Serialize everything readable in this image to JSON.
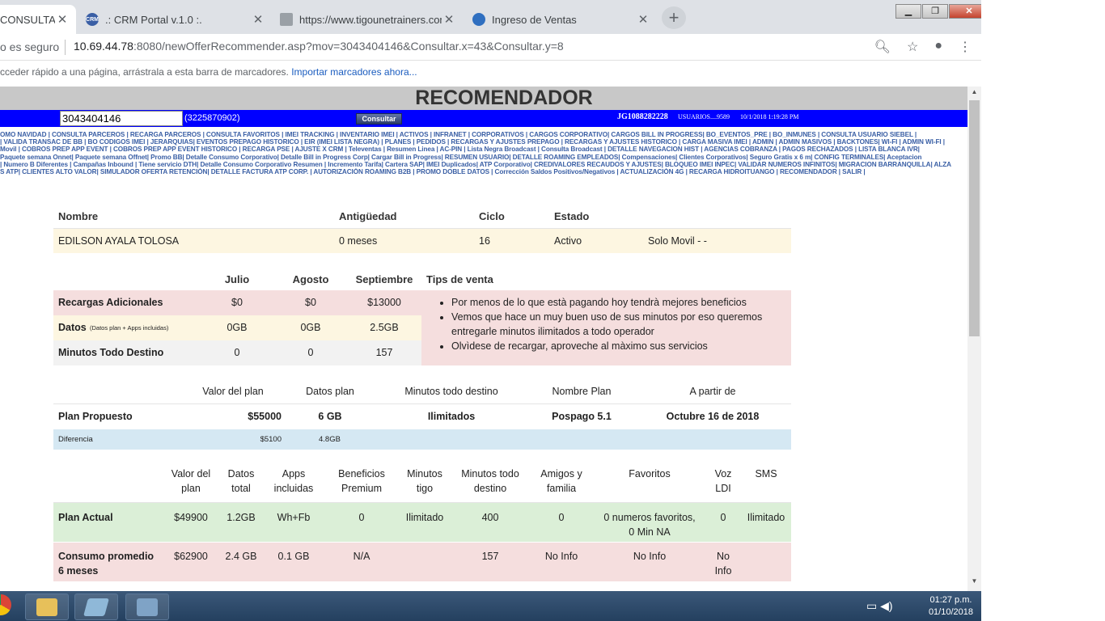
{
  "browser": {
    "tabs": [
      {
        "title": "CONSULTA IN",
        "active": true,
        "icon": "page-icon",
        "color": "#ffffff"
      },
      {
        "title": ".: CRM Portal v.1.0 :.",
        "active": false,
        "icon": "crm-icon",
        "color": "#3a5fa5"
      },
      {
        "title": "https://www.tigounetrainers.com",
        "active": false,
        "icon": "document-icon",
        "color": "#9aa0a6"
      },
      {
        "title": "Ingreso de Ventas",
        "active": false,
        "icon": "sales-icon",
        "color": "#2f6fc0"
      }
    ],
    "security_label": "o es seguro",
    "url_host": "10.69.44.78",
    "url_rest": ":8080/newOfferRecommender.asp?mov=3043404146&Consultar.x=43&Consultar.y=8",
    "bookmarks_prompt": "cceder rápido a una página, arrástrala a esta barra de marcadores.",
    "bookmarks_link": "Importar marcadores ahora..."
  },
  "header": {
    "title": "RECOMENDADOR",
    "msisdn_value": "3043404146",
    "alt_number": "(3225870902)",
    "consultar_label": "Consultar",
    "user_id": "JG1088282228",
    "user_meta": "USUARIOS....9589",
    "user_date": "10/1/2018 1:19:28 PM"
  },
  "menu_lines": [
    "OMO NAVIDAD | CONSULTA PARCEROS | RECARGA PARCEROS | CONSULTA FAVORITOS | IMEI TRACKING | INVENTARIO IMEI | ACTIVOS | INFRANET | CORPORATIVOS | CARGOS CORPORATIVO| CARGOS BILL IN PROGRESS| BO_EVENTOS_PRE | BO_INMUNES | CONSULTA USUARIO SIEBEL |",
    "| VALIDA TRANSAC DE BB | BO CODIGOS IMEI | JERARQUIAS| EVENTOS PREPAGO HISTORICO | EIR (IMEI LISTA NEGRA) | PLANES | PEDIDOS | RECARGAS Y AJUSTES PREPAGO | RECARGAS Y AJUSTES HISTORICO | CARGA MASIVA IMEI | ADMIN | ADMIN MASIVOS | BACKTONES| WI-FI | ADMIN WI-FI |",
    "Movil | COBROS PREP APP EVENT | COBROS PREP APP EVENT HISTORICO | RECARGA PSE | AJUSTE X CRM | Televentas | Resumen Linea | AC-PIN | Lista Negra Broadcast | Consulta Broadcast | DETALLE NAVEGACION HIST | AGENCIAS COBRANZA | PAGOS RECHAZADOS | LISTA BLANCA IVR|",
    "Paquete semana Onnet| Paquete semana Offnet| Promo BB| Detalle Consumo Corporativo| Detalle Bill in Progress Corp| Cargar Bill in Progress| RESUMEN USUARIO| DETALLE ROAMING EMPLEADOS| Compensaciones| Clientes Corporativos| Seguro Gratis x 6 m| CONFIG TERMINALES| Aceptacion",
    "| Numero B Diferentes | Campañas Inbound | Tiene servicio DTH| Detalle Consumo Corporativo Resumen | Incremento Tarifa| Cartera SAP| IMEI Duplicados| ATP Corporativo| CREDIVALORES RECAUDOS Y AJUSTES| BLOQUEO IMEI INPEC| VALIDAR NUMEROS INFINITOS| MIGRACION BARRANQUILLA| ALZA",
    "S ATP| CLIENTES ALTO VALOR| SIMULADOR OFERTA RETENCIÓN| DETALLE FACTURA ATP CORP. | AUTORIZACIÓN ROAMING B2B | PROMO DOBLE DATOS | Corrección Saldos Positivos/Negativos | ACTUALIZACIÓN 4G | RECARGA HIDROITUANGO | RECOMENDADOR | SALIR |"
  ],
  "customer": {
    "headers": {
      "nombre": "Nombre",
      "antiguedad": "Antigüedad",
      "ciclo": "Ciclo",
      "estado": "Estado"
    },
    "nombre": "EDILSON AYALA TOLOSA",
    "antiguedad": "0 meses",
    "ciclo": "16",
    "estado": "Activo",
    "tipo": "Solo Movil - -"
  },
  "usage": {
    "months": [
      "Julio",
      "Agosto",
      "Septiembre"
    ],
    "tips_header": "Tips de venta",
    "rows": [
      {
        "label": "Recargas Adicionales",
        "note": "",
        "values": [
          "$0",
          "$0",
          "$13000"
        ]
      },
      {
        "label": "Datos",
        "note": "(Datos plan + Apps incluidas)",
        "values": [
          "0GB",
          "0GB",
          "2.5GB"
        ]
      },
      {
        "label": "Minutos Todo Destino",
        "note": "",
        "values": [
          "0",
          "0",
          "157"
        ]
      }
    ],
    "tips": [
      "Por menos de lo que està pagando hoy tendrà mejores beneficios",
      "Vemos que hace un muy buen uso de sus minutos por eso queremos entregarle minutos ilimitados a todo operador",
      "Olvìdese de recargar, aproveche al màximo sus servicios"
    ]
  },
  "proposal": {
    "headers": [
      "Valor del plan",
      "Datos plan",
      "Minutos todo destino",
      "Nombre Plan",
      "A partir de"
    ],
    "label": "Plan Propuesto",
    "values": [
      "$55000",
      "6 GB",
      "Ilimitados",
      "Pospago 5.1",
      "Octubre 16 de 2018"
    ],
    "diff_label": "Diferencia",
    "diff_values": [
      "$5100",
      "4.8GB"
    ]
  },
  "current_plan": {
    "headers": [
      [
        "Valor del",
        "plan"
      ],
      [
        "Datos",
        "total"
      ],
      [
        "Apps",
        "incluidas"
      ],
      [
        "Beneficios",
        "Premium"
      ],
      [
        "Minutos",
        "tigo"
      ],
      [
        "Minutos todo",
        "destino"
      ],
      [
        "Amigos y",
        "familia"
      ],
      [
        "Favoritos",
        ""
      ],
      [
        "Voz",
        "LDI"
      ],
      [
        "SMS",
        ""
      ]
    ],
    "rows": [
      {
        "label": [
          "Plan Actual",
          ""
        ],
        "values": [
          [
            "$49900"
          ],
          [
            "1.2GB"
          ],
          [
            "Wh+Fb"
          ],
          [
            "0"
          ],
          [
            "Ilimitado"
          ],
          [
            "400"
          ],
          [
            "0"
          ],
          [
            "0 numeros favoritos,",
            "0 Min NA"
          ],
          [
            "0"
          ],
          [
            "Ilimitado"
          ]
        ]
      },
      {
        "label": [
          "Consumo promedio",
          "6 meses"
        ],
        "values": [
          [
            "$62900"
          ],
          [
            "2.4 GB"
          ],
          [
            "0.1 GB"
          ],
          [
            "N/A"
          ],
          [
            ""
          ],
          [
            "157"
          ],
          [
            "No Info"
          ],
          [
            "No Info"
          ],
          [
            "No",
            "Info"
          ],
          [
            ""
          ]
        ]
      }
    ]
  },
  "taskbar": {
    "time": "01:27 p.m.",
    "date": "01/10/2018"
  }
}
